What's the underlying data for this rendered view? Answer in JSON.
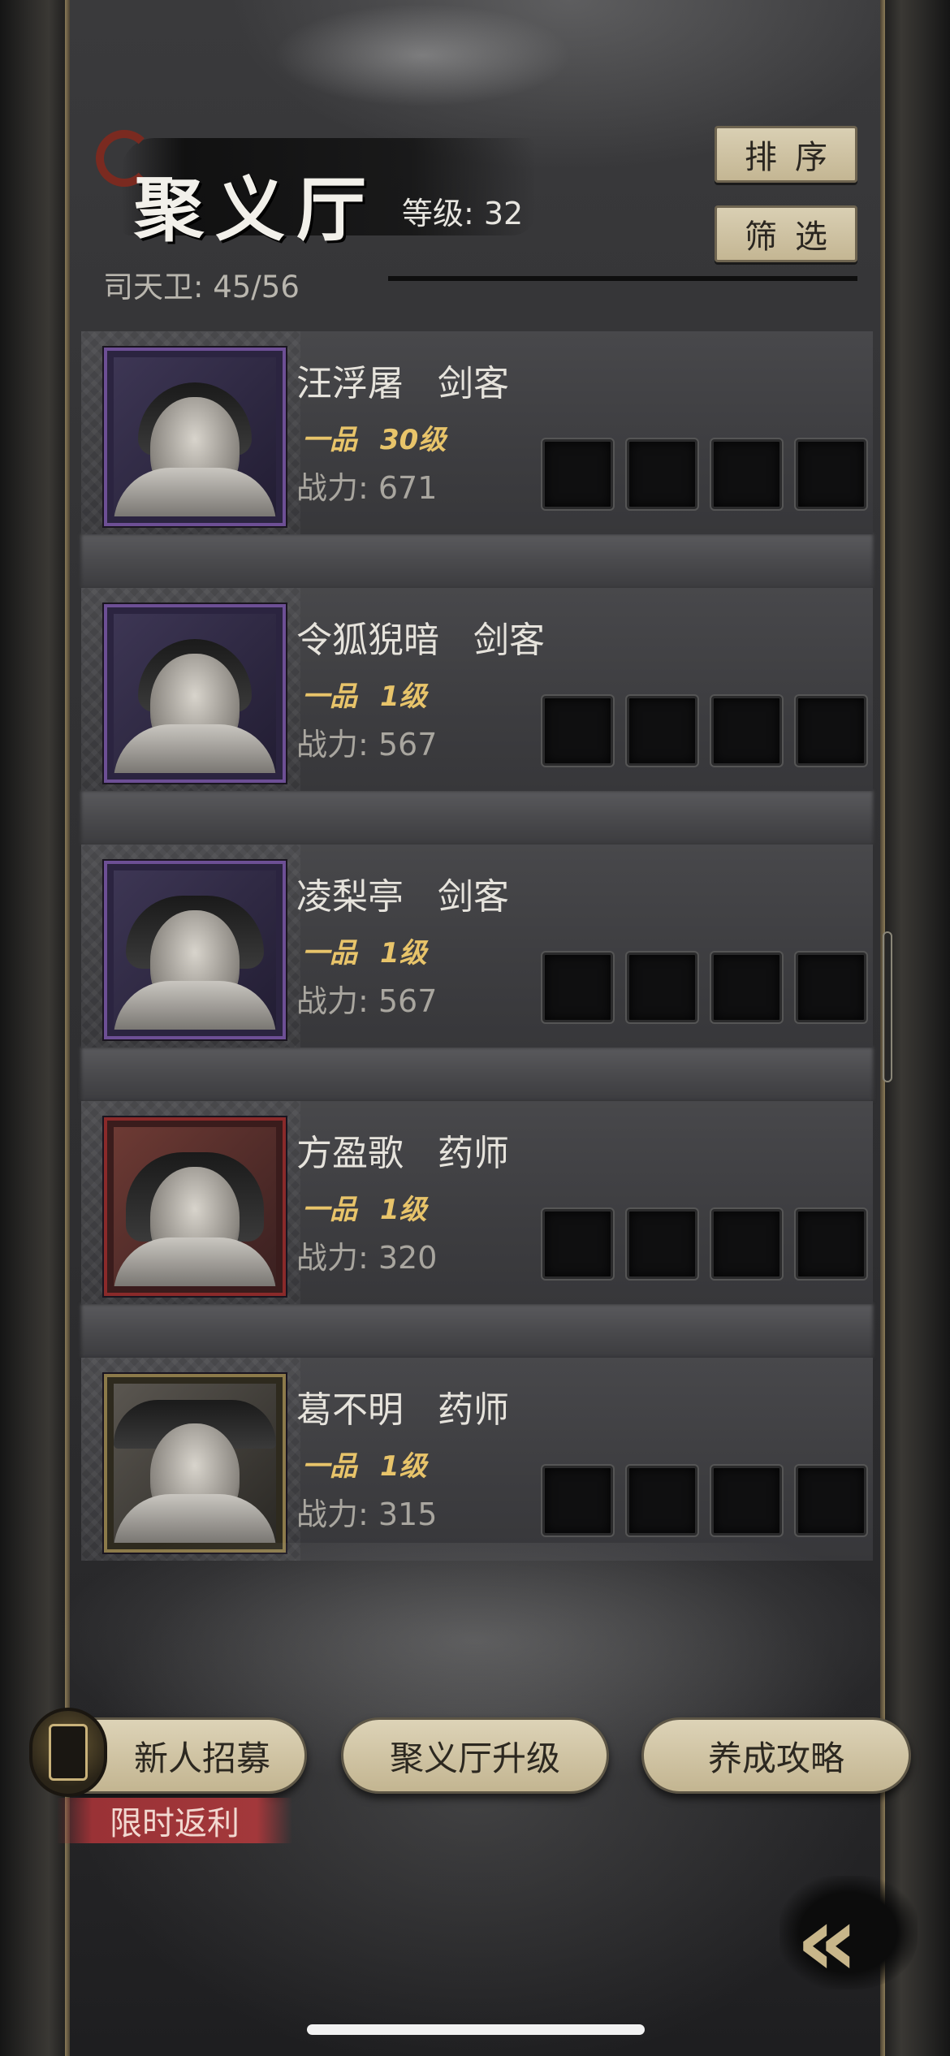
{
  "header": {
    "title": "聚义厅",
    "level_text": "等级: 32",
    "roster_count": "司天卫: 45/56",
    "sort_label": "排序",
    "filter_label": "筛选"
  },
  "heroes": [
    {
      "name": "汪浮屠   剑客",
      "grade": "一品",
      "level": "30级",
      "power": "战力: 671"
    },
    {
      "name": "令狐猊暗   剑客",
      "grade": "一品",
      "level": "1级",
      "power": "战力: 567"
    },
    {
      "name": "凌梨亭   剑客",
      "grade": "一品",
      "level": "1级",
      "power": "战力: 567"
    },
    {
      "name": "方盈歌   药师",
      "grade": "一品",
      "level": "1级",
      "power": "战力: 320"
    },
    {
      "name": "葛不明   药师",
      "grade": "一品",
      "level": "1级",
      "power": "战力: 315"
    }
  ],
  "bottom_bar": {
    "recruit_label": "新人招募",
    "upgrade_label": "聚义厅升级",
    "guide_label": "养成攻略",
    "promo_tag": "限时返利"
  },
  "icons": {
    "back": "double-chevron-left-icon",
    "recruit": "token-plaque-icon"
  },
  "colors": {
    "button_bg": "#d4c8a8",
    "grade_gold": "#e8c46a",
    "promo_red": "#a3383b",
    "portrait_purple": "#6d4f95",
    "portrait_red": "#8a2a2a",
    "portrait_gold": "#8c7a4a"
  }
}
